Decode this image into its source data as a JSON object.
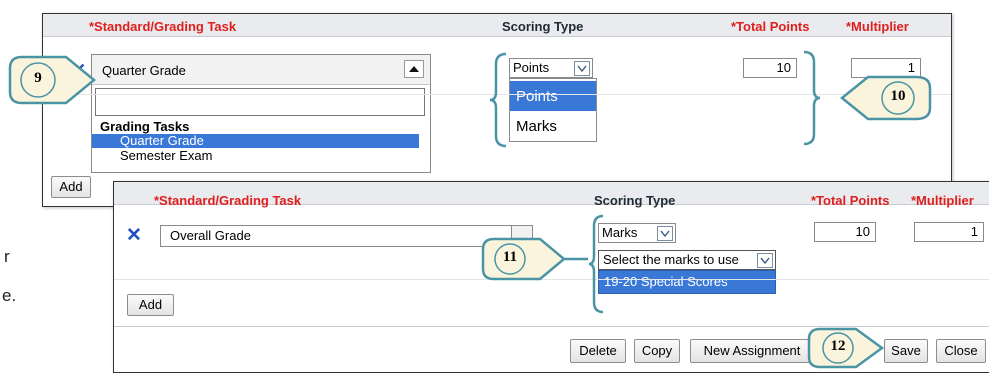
{
  "panel_top": {
    "headers": {
      "standard_task": "*Standard/Grading Task",
      "scoring_type": "Scoring Type",
      "total_points": "*Total Points",
      "multiplier": "*Multiplier"
    },
    "task_select": {
      "value": "Quarter Grade",
      "search_value": "",
      "group_label": "Grading Tasks",
      "options": [
        "Quarter Grade",
        "Semester Exam"
      ],
      "selected_option": "Quarter Grade"
    },
    "scoring_select": {
      "value": "Points",
      "options": [
        "Points",
        "Marks"
      ],
      "highlighted": "Points"
    },
    "total_points_value": "10",
    "multiplier_value": "1",
    "add_button": "Add"
  },
  "panel_bottom": {
    "headers": {
      "standard_task": "*Standard/Grading Task",
      "scoring_type": "Scoring Type",
      "total_points": "*Total Points",
      "multiplier": "*Multiplier"
    },
    "task_value": "Overall Grade",
    "scoring_value": "Marks",
    "marks_select": {
      "placeholder": "Select the marks to use",
      "options": [
        "19-20 Special Scores"
      ]
    },
    "total_points_value": "10",
    "multiplier_value": "1",
    "add_button": "Add",
    "footer_buttons": {
      "delete": "Delete",
      "copy": "Copy",
      "new_assignment": "New Assignment",
      "save": "Save",
      "close": "Close"
    }
  },
  "callouts": [
    "9",
    "10",
    "11",
    "12"
  ],
  "background_text": [
    "r",
    "e."
  ],
  "colors": {
    "required_red": "#e0201f",
    "highlight_blue": "#3a78d8",
    "callout_teal": "#4b94a6",
    "callout_fill": "#fbf4dc",
    "remove_x_blue": "#1f4fc0"
  }
}
